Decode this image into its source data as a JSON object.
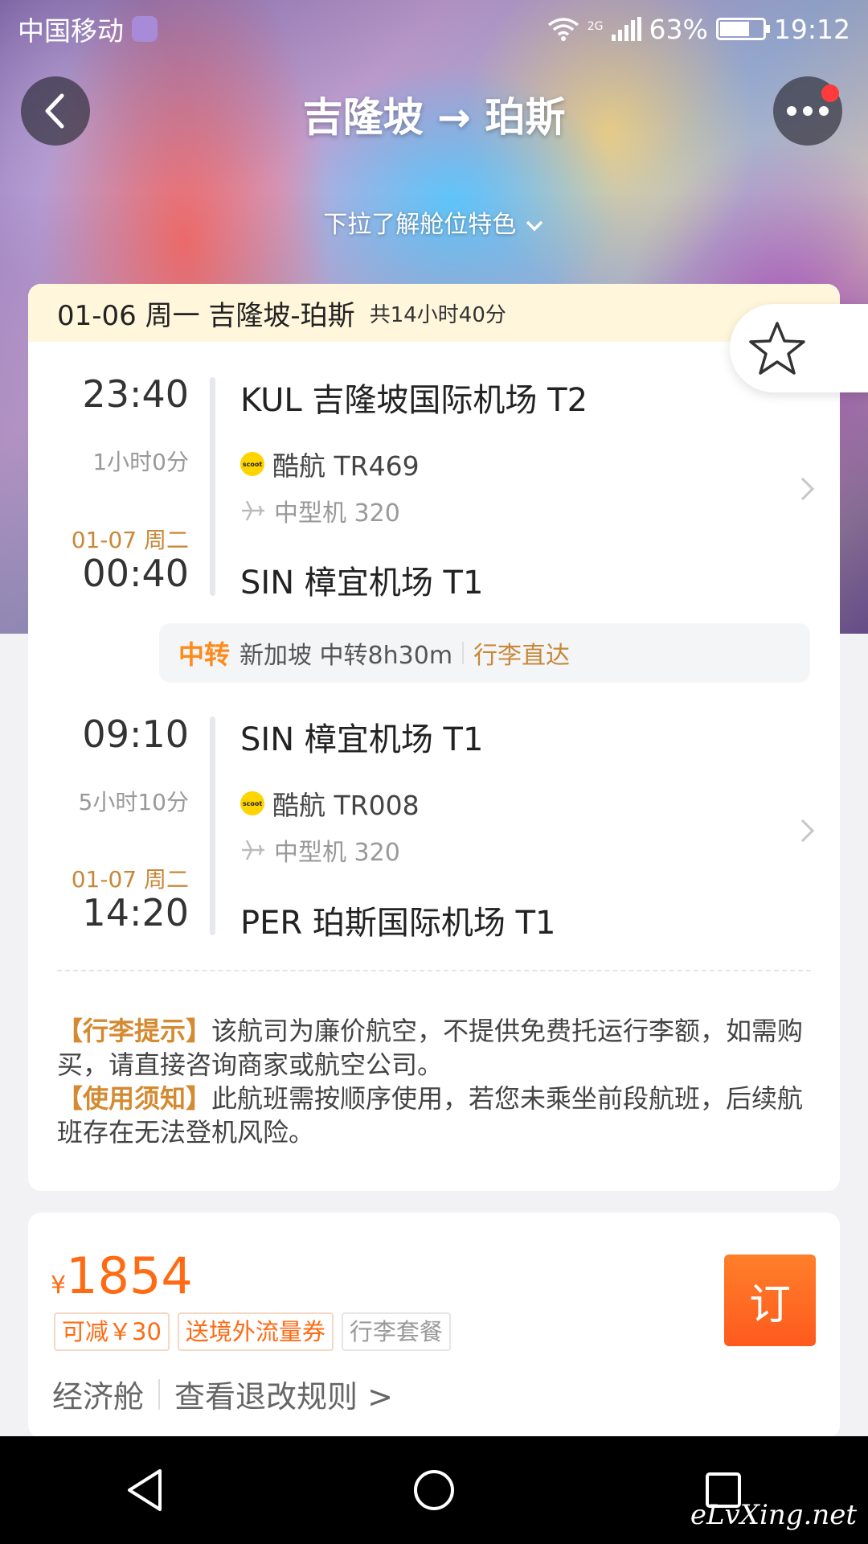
{
  "status_bar": {
    "carrier": "中国移动",
    "network": "2G",
    "battery": "63%",
    "time": "19:12"
  },
  "header": {
    "title": "吉隆坡 → 珀斯",
    "pulldown_hint": "下拉了解舱位特色"
  },
  "trip": {
    "date": "01-06 周一 吉隆坡-珀斯",
    "total_duration": "共14小时40分"
  },
  "segments": [
    {
      "dep_time": "23:40",
      "dep_airport": "KUL 吉隆坡国际机场 T2",
      "duration": "1小时0分",
      "airline_logo": "scoot",
      "flight": "酷航 TR469",
      "aircraft": "中型机 320",
      "arr_date": "01-07 周二",
      "arr_time": "00:40",
      "arr_airport": "SIN 樟宜机场 T1"
    },
    {
      "dep_time": "09:10",
      "dep_airport": "SIN 樟宜机场 T1",
      "duration": "5小时10分",
      "airline_logo": "scoot",
      "flight": "酷航 TR008",
      "aircraft": "中型机 320",
      "arr_date": "01-07 周二",
      "arr_time": "14:20",
      "arr_airport": "PER 珀斯国际机场 T1"
    }
  ],
  "transfer": {
    "tag": "中转",
    "info": "新加坡 中转8h30m",
    "baggage": "行李直达"
  },
  "notices": {
    "baggage_title": "【行李提示】",
    "baggage_text": "该航司为廉价航空，不提供免费托运行李额，如需购买，请直接咨询商家或航空公司。",
    "usage_title": "【使用须知】",
    "usage_text": "此航班需按顺序使用，若您未乘坐前段航班，后续航班存在无法登机风险。"
  },
  "price_card": {
    "currency": "¥",
    "price": "1854",
    "chips": [
      "可减￥30",
      "送境外流量券",
      "行李套餐"
    ],
    "cabin": "经济舱",
    "rules_link": "查看退改规则 >",
    "book_label": "订"
  },
  "watermark": "eLvXing.net",
  "colors": {
    "accent_orange": "#ff6a13",
    "transfer_orange": "#ff8a1c",
    "date_gold": "#c8883a",
    "date_bar_bg": "#fff6dc"
  }
}
